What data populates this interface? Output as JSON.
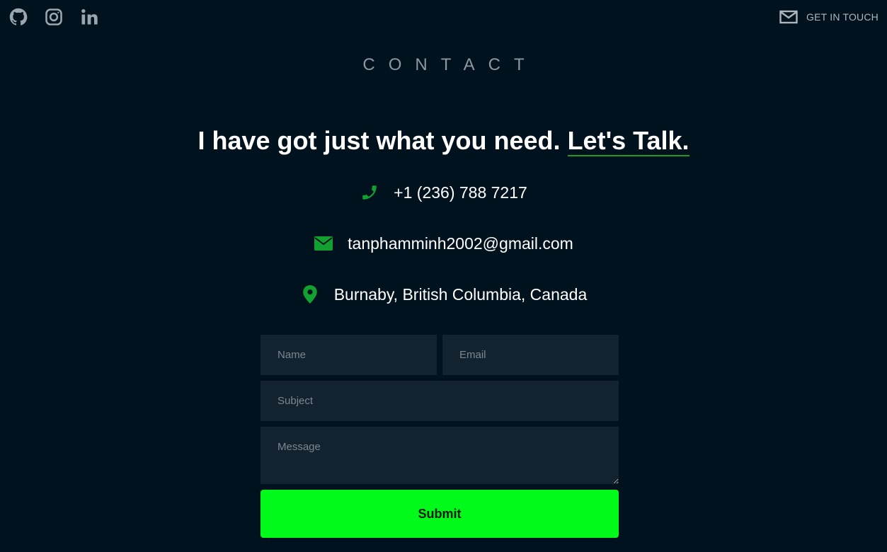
{
  "nav": {
    "social": [
      {
        "name": "github-icon"
      },
      {
        "name": "instagram-icon"
      },
      {
        "name": "linkedin-icon"
      }
    ],
    "get_in_touch": "GET IN TOUCH"
  },
  "contact": {
    "section_title": "CONTACT",
    "headline_text": "I have got just what you need. ",
    "headline_link": "Let's Talk.",
    "phone": "+1 (236) 788 7217",
    "email": "tanphamminh2002@gmail.com",
    "location": "Burnaby, British Columbia, Canada"
  },
  "form": {
    "name_placeholder": "Name",
    "email_placeholder": "Email",
    "subject_placeholder": "Subject",
    "message_placeholder": "Message",
    "submit_label": "Submit"
  },
  "colors": {
    "background": "#01121f",
    "accent": "#02fa1b",
    "icon_green": "#12a130",
    "field_bg": "#13222f"
  }
}
